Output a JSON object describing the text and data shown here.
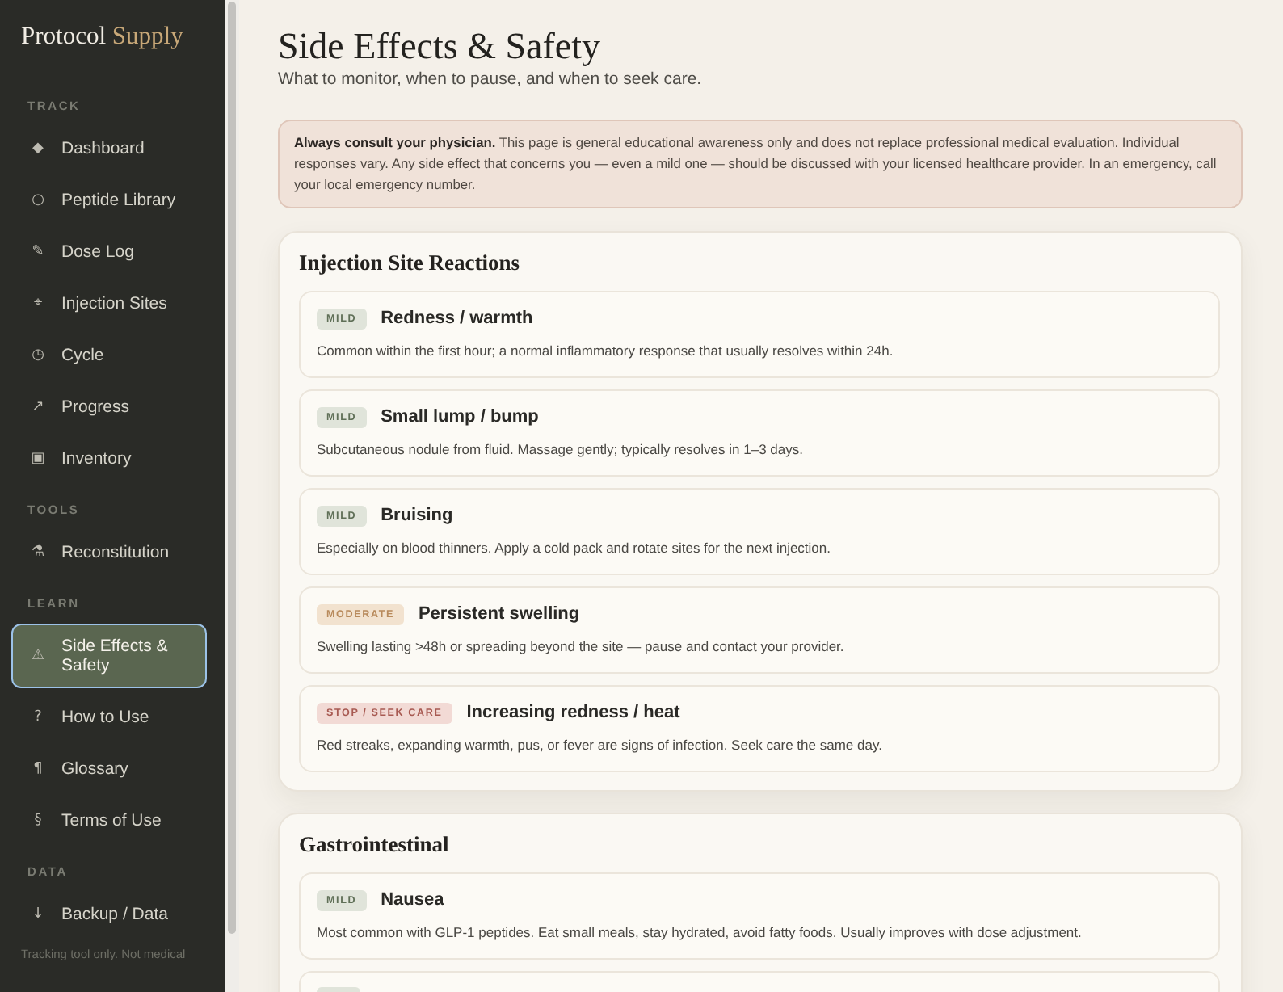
{
  "sidebar": {
    "logo": {
      "primary": "Protocol",
      "accent": "Supply"
    },
    "sections": [
      {
        "label": "TRACK",
        "items": [
          {
            "icon": "◆",
            "label": "Dashboard",
            "selected": false
          },
          {
            "icon": "○",
            "label": "Peptide Library",
            "selected": false
          },
          {
            "icon": "✎",
            "label": "Dose Log",
            "selected": false
          },
          {
            "icon": "⌖",
            "label": "Injection Sites",
            "selected": false
          },
          {
            "icon": "◷",
            "label": "Cycle",
            "selected": false
          },
          {
            "icon": "↗",
            "label": "Progress",
            "selected": false
          },
          {
            "icon": "▣",
            "label": "Inventory",
            "selected": false
          }
        ]
      },
      {
        "label": "TOOLS",
        "items": [
          {
            "icon": "⚗",
            "label": "Reconstitution",
            "selected": false
          }
        ]
      },
      {
        "label": "LEARN",
        "items": [
          {
            "icon": "⚠",
            "label": "Side Effects & Safety",
            "selected": true
          },
          {
            "icon": "?",
            "label": "How to Use",
            "selected": false
          },
          {
            "icon": "¶",
            "label": "Glossary",
            "selected": false
          },
          {
            "icon": "§",
            "label": "Terms of Use",
            "selected": false
          }
        ]
      },
      {
        "label": "DATA",
        "items": [
          {
            "icon": "↓",
            "label": "Backup / Data",
            "selected": false
          }
        ]
      }
    ],
    "footer": "Tracking tool only. Not medical"
  },
  "page": {
    "title": "Side Effects & Safety",
    "subtitle": "What to monitor, when to pause, and when to seek care."
  },
  "notice": {
    "text": "**Always consult your physician.** This page is general educational awareness only and does not replace professional medical evaluation. Individual responses vary. Any side effect that concerns you — even a mild one — should be discussed with your licensed healthcare provider. In an emergency, call your local emergency number."
  },
  "sections": [
    {
      "heading": "Injection Site Reactions",
      "items": [
        {
          "kind": "mild",
          "badge": "MILD",
          "title": "Redness / warmth",
          "description": "Common within the first hour; a normal inflammatory response that usually resolves within 24h."
        },
        {
          "kind": "mild",
          "badge": "MILD",
          "title": "Small lump / bump",
          "description": "Subcutaneous nodule from fluid. Massage gently; typically resolves in 1–3 days."
        },
        {
          "kind": "mild",
          "badge": "MILD",
          "title": "Bruising",
          "description": "Especially on blood thinners. Apply a cold pack and rotate sites for the next injection."
        },
        {
          "kind": "moderate",
          "badge": "MODERATE",
          "title": "Persistent swelling",
          "description": "Swelling lasting >48h or spreading beyond the site — pause and contact your provider."
        },
        {
          "kind": "stop",
          "badge": "STOP / SEEK CARE",
          "title": "Increasing redness / heat",
          "description": "Red streaks, expanding warmth, pus, or fever are signs of infection. Seek care the same day."
        }
      ]
    },
    {
      "heading": "Gastrointestinal",
      "items": [
        {
          "kind": "mild",
          "badge": "MILD",
          "title": "Nausea",
          "description": "Most common with GLP-1 peptides. Eat small meals, stay hydrated, avoid fatty foods. Usually improves with dose adjustment."
        },
        {
          "kind": "mild"
        }
      ]
    }
  ]
}
